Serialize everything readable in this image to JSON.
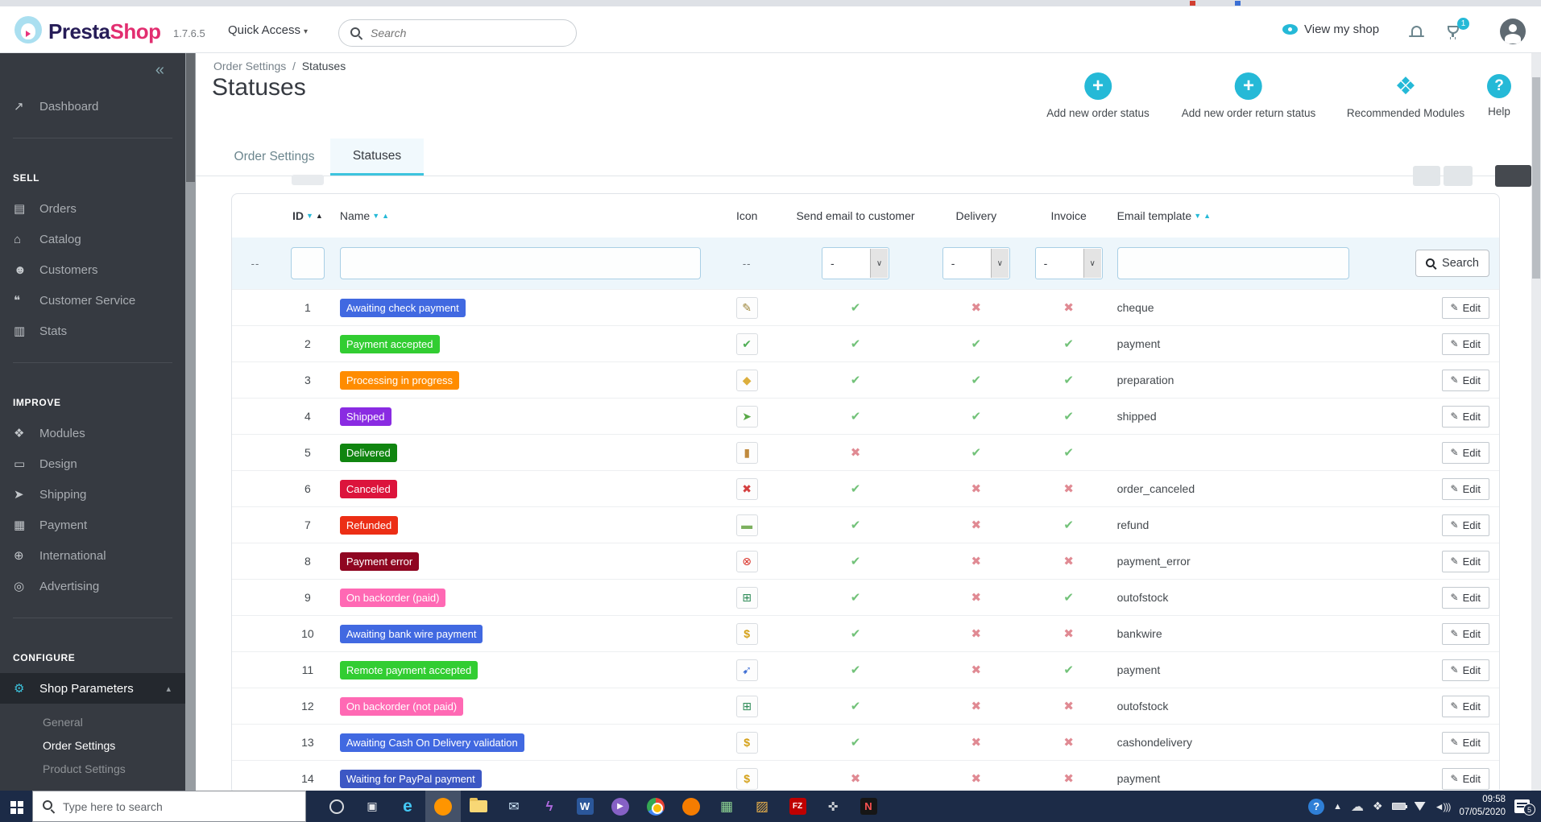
{
  "colors": {
    "accent": "#25B9D7",
    "sidebar_bg": "#363A41",
    "taskbar_bg": "#1C2B47"
  },
  "header": {
    "brand": {
      "name_primary": "Presta",
      "name_secondary": "Shop",
      "version": "1.7.6.5"
    },
    "quick_access": {
      "label": "Quick Access",
      "caret": "▾"
    },
    "search_placeholder": "Search",
    "view_my_shop": "View my shop",
    "trophy_badge": "1"
  },
  "sidebar": {
    "collapse_glyph": "«",
    "dashboard": {
      "label": "Dashboard",
      "icon": "dashboard-icon",
      "glyph": "↗"
    },
    "sections": [
      {
        "title": "SELL",
        "items": [
          {
            "label": "Orders",
            "icon": "orders-icon",
            "glyph": "▤"
          },
          {
            "label": "Catalog",
            "icon": "catalog-icon",
            "glyph": "⌂"
          },
          {
            "label": "Customers",
            "icon": "customers-icon",
            "glyph": "☻"
          },
          {
            "label": "Customer Service",
            "icon": "customer-service-icon",
            "glyph": "❝"
          },
          {
            "label": "Stats",
            "icon": "stats-icon",
            "glyph": "▥"
          }
        ]
      },
      {
        "title": "IMPROVE",
        "items": [
          {
            "label": "Modules",
            "icon": "modules-icon",
            "glyph": "❖"
          },
          {
            "label": "Design",
            "icon": "design-icon",
            "glyph": "▭"
          },
          {
            "label": "Shipping",
            "icon": "shipping-icon",
            "glyph": "➤"
          },
          {
            "label": "Payment",
            "icon": "payment-icon",
            "glyph": "▦"
          },
          {
            "label": "International",
            "icon": "international-icon",
            "glyph": "⊕"
          },
          {
            "label": "Advertising",
            "icon": "advertising-icon",
            "glyph": "◎"
          }
        ]
      },
      {
        "title": "CONFIGURE",
        "items": [
          {
            "label": "Shop Parameters",
            "icon": "shop-parameters-icon",
            "glyph": "⚙",
            "active": true,
            "chevron": "▴",
            "children": [
              {
                "label": "General"
              },
              {
                "label": "Order Settings",
                "active": true
              },
              {
                "label": "Product Settings"
              }
            ]
          }
        ]
      }
    ]
  },
  "page": {
    "breadcrumb": {
      "parent": "Order Settings",
      "separator": "/",
      "current": "Statuses"
    },
    "title": "Statuses",
    "actions": [
      {
        "label": "Add new order status",
        "icon": "add-plus-icon",
        "type": "plus",
        "glyph": "+"
      },
      {
        "label": "Add new order return status",
        "icon": "add-plus-icon",
        "type": "plus",
        "glyph": "+"
      },
      {
        "label": "Recommended Modules",
        "icon": "modules-puzzle-icon",
        "type": "puzzle",
        "glyph": "❖"
      },
      {
        "label": "Help",
        "icon": "help-icon",
        "type": "help",
        "glyph": "?"
      }
    ],
    "tabs": [
      {
        "label": "Order Settings",
        "active": false
      },
      {
        "label": "Statuses",
        "active": true
      }
    ]
  },
  "table": {
    "columns": {
      "id": "ID",
      "name": "Name",
      "icon": "Icon",
      "send_email": "Send email to customer",
      "delivery": "Delivery",
      "invoice": "Invoice",
      "email_template": "Email template"
    },
    "sort": {
      "down": "▼",
      "up": "▲"
    },
    "filters": {
      "blank": "--",
      "icon_blank": "--",
      "select_value": "-",
      "select_caret": "∨",
      "search_label": "Search"
    },
    "edit": {
      "label": "Edit",
      "glyph": "✎"
    },
    "marks": {
      "yes": "✔",
      "yes_color": "#72C279",
      "no": "✖",
      "no_color": "#E08A93"
    },
    "status_icons": {
      "cheque-icon": {
        "glyph": "✎",
        "color": "#9c8438"
      },
      "check-icon": {
        "glyph": "✔",
        "color": "#4fae55"
      },
      "package-icon": {
        "glyph": "◆",
        "color": "#dcae3c"
      },
      "truck-icon": {
        "glyph": "➤",
        "color": "#58a846"
      },
      "door-icon": {
        "glyph": "▮",
        "color": "#c08a3e"
      },
      "cancel-icon": {
        "glyph": "✖",
        "color": "#d43f3f"
      },
      "refund-icon": {
        "glyph": "▬",
        "color": "#7cb05e"
      },
      "payment-error-icon": {
        "glyph": "⊗",
        "color": "#d9342b"
      },
      "cart-icon": {
        "glyph": "⊞",
        "color": "#2e8b57"
      },
      "coins-icon": {
        "glyph": "$",
        "color": "#d4a017",
        "bold": true
      },
      "dart-icon": {
        "glyph": "➹",
        "color": "#3f6fd4"
      }
    },
    "rows": [
      {
        "id": "1",
        "name": "Awaiting check payment",
        "color": "#4169E1",
        "icon": "cheque-icon",
        "send_email": true,
        "delivery": false,
        "invoice": false,
        "template": "cheque"
      },
      {
        "id": "2",
        "name": "Payment accepted",
        "color": "#32CD32",
        "icon": "check-icon",
        "send_email": true,
        "delivery": true,
        "invoice": true,
        "template": "payment"
      },
      {
        "id": "3",
        "name": "Processing in progress",
        "color": "#FF8C00",
        "icon": "package-icon",
        "send_email": true,
        "delivery": true,
        "invoice": true,
        "template": "preparation"
      },
      {
        "id": "4",
        "name": "Shipped",
        "color": "#8A2BE2",
        "icon": "truck-icon",
        "send_email": true,
        "delivery": true,
        "invoice": true,
        "template": "shipped"
      },
      {
        "id": "5",
        "name": "Delivered",
        "color": "#108510",
        "icon": "door-icon",
        "send_email": false,
        "delivery": true,
        "invoice": true,
        "template": ""
      },
      {
        "id": "6",
        "name": "Canceled",
        "color": "#DC143C",
        "icon": "cancel-icon",
        "send_email": true,
        "delivery": false,
        "invoice": false,
        "template": "order_canceled"
      },
      {
        "id": "7",
        "name": "Refunded",
        "color": "#EC2E15",
        "icon": "refund-icon",
        "send_email": true,
        "delivery": false,
        "invoice": true,
        "template": "refund"
      },
      {
        "id": "8",
        "name": "Payment error",
        "color": "#8F0621",
        "icon": "payment-error-icon",
        "send_email": true,
        "delivery": false,
        "invoice": false,
        "template": "payment_error"
      },
      {
        "id": "9",
        "name": "On backorder (paid)",
        "color": "#FF69B4",
        "icon": "cart-icon",
        "send_email": true,
        "delivery": false,
        "invoice": true,
        "template": "outofstock"
      },
      {
        "id": "10",
        "name": "Awaiting bank wire payment",
        "color": "#4169E1",
        "icon": "coins-icon",
        "send_email": true,
        "delivery": false,
        "invoice": false,
        "template": "bankwire"
      },
      {
        "id": "11",
        "name": "Remote payment accepted",
        "color": "#32CD32",
        "icon": "dart-icon",
        "send_email": true,
        "delivery": false,
        "invoice": true,
        "template": "payment"
      },
      {
        "id": "12",
        "name": "On backorder (not paid)",
        "color": "#FF69B4",
        "icon": "cart-icon",
        "send_email": true,
        "delivery": false,
        "invoice": false,
        "template": "outofstock"
      },
      {
        "id": "13",
        "name": "Awaiting Cash On Delivery validation",
        "color": "#4169E1",
        "icon": "coins-icon",
        "send_email": true,
        "delivery": false,
        "invoice": false,
        "template": "cashondelivery"
      },
      {
        "id": "14",
        "name": "Waiting for PayPal payment",
        "color": "#3C57C4",
        "icon": "coins-icon",
        "send_email": false,
        "delivery": false,
        "invoice": false,
        "template": "payment"
      }
    ]
  },
  "taskbar": {
    "search_placeholder": "Type here to search",
    "apps": [
      {
        "name": "cortana-icon",
        "shape": "ring"
      },
      {
        "name": "taskview-icon",
        "glyph": "▣",
        "fg": "#e8eaed",
        "shape": "glyph"
      },
      {
        "name": "edge-icon",
        "glyph": "e",
        "fg": "#44c8f5",
        "shape": "glyph",
        "size": 21,
        "bold": true
      },
      {
        "name": "firefox-icon",
        "shape": "circle",
        "bg": "#ff9500",
        "active": true
      },
      {
        "name": "explorer-icon",
        "shape": "folder"
      },
      {
        "name": "mail-icon",
        "glyph": "✉",
        "fg": "#cfe6f8",
        "shape": "glyph",
        "size": 16
      },
      {
        "name": "lightning-icon",
        "glyph": "ϟ",
        "fg": "#b06ae0",
        "shape": "glyph",
        "size": 17,
        "bold": true
      },
      {
        "name": "word-icon",
        "glyph": "W",
        "fg": "#ffffff",
        "bg": "#2b579a",
        "shape": "square"
      },
      {
        "name": "media-player-icon",
        "glyph": "▶",
        "fg": "#ffffff",
        "bg": "#8661c5",
        "shape": "circle-glyph"
      },
      {
        "name": "chrome-icon",
        "shape": "chrome"
      },
      {
        "name": "orange-app-icon",
        "shape": "circle",
        "bg": "#f57c00"
      },
      {
        "name": "spreadsheet-icon",
        "glyph": "▦",
        "fg": "#8fd694",
        "shape": "glyph",
        "size": 17
      },
      {
        "name": "paint-icon",
        "glyph": "▨",
        "fg": "#e8b04a",
        "shape": "glyph",
        "size": 17
      },
      {
        "name": "filezilla-icon",
        "glyph": "FZ",
        "fg": "#ffffff",
        "bg": "#bf0000",
        "shape": "square",
        "size": 10
      },
      {
        "name": "tools-icon",
        "glyph": "✜",
        "fg": "#c9ccd1",
        "shape": "glyph",
        "size": 15
      },
      {
        "name": "notepad-icon",
        "glyph": "N",
        "fg": "#ff5252",
        "bg": "#161616",
        "shape": "square"
      }
    ],
    "tray": {
      "time": "09:58",
      "date": "07/05/2020",
      "notification_badge": "5"
    }
  }
}
